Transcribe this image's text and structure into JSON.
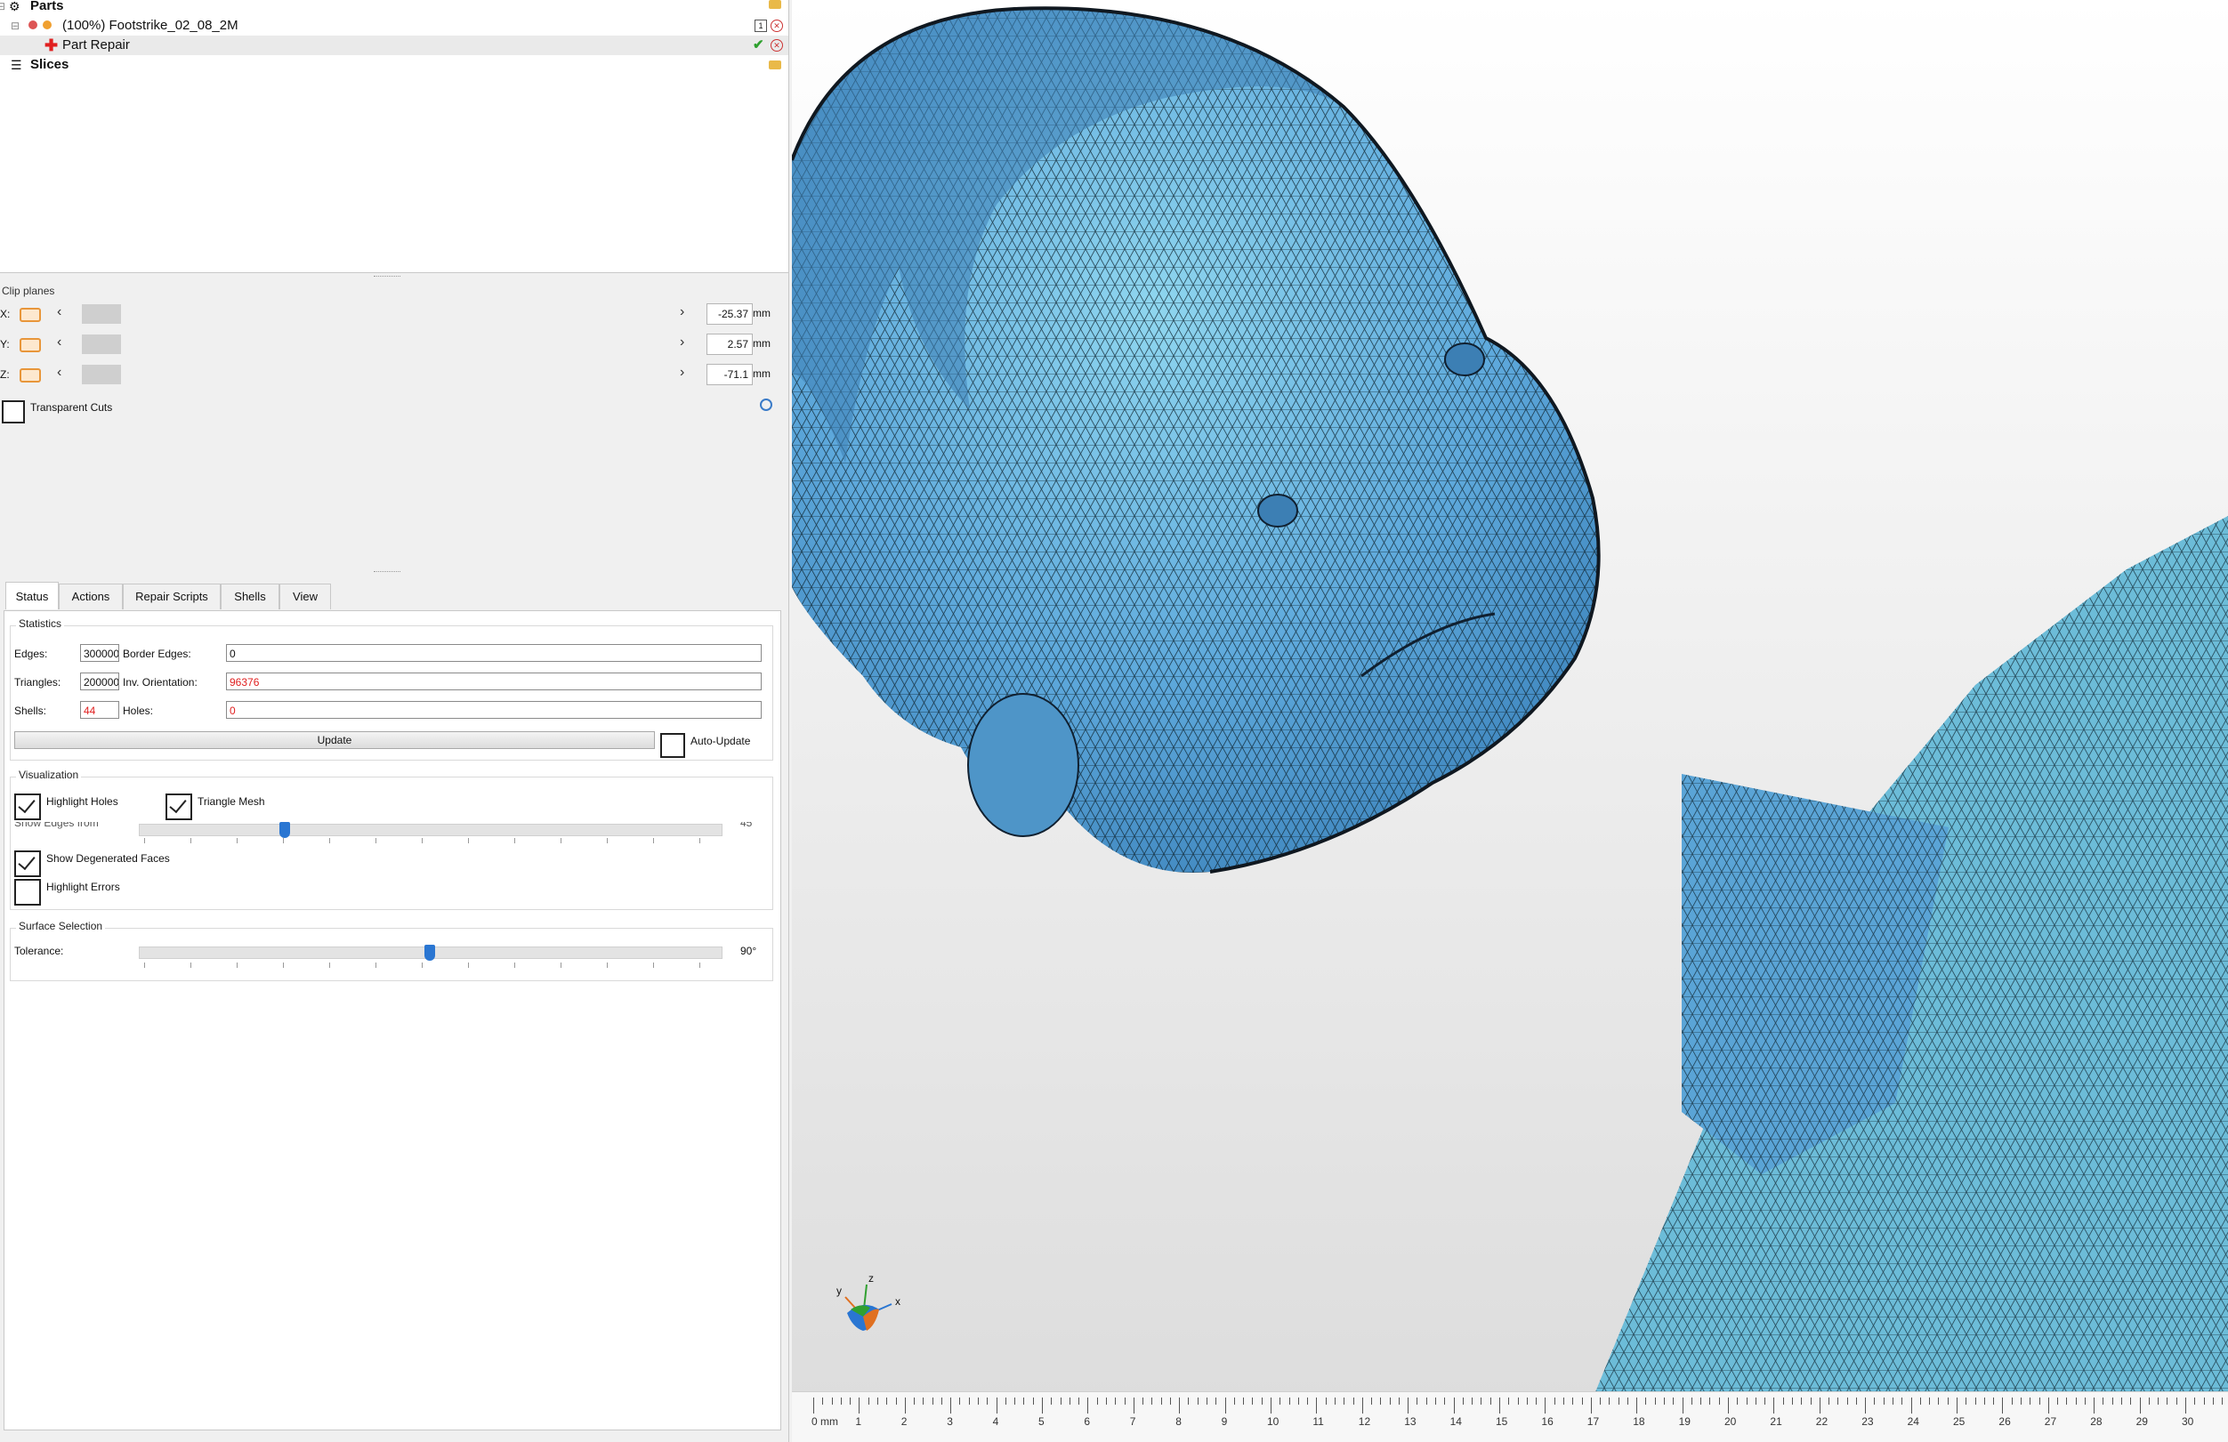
{
  "tree": {
    "parts_label": "Parts",
    "part_name": "(100%) Footstrike_02_08_2M",
    "part_badge": "1",
    "repair_label": "Part Repair",
    "slices_label": "Slices"
  },
  "clip_planes": {
    "title": "Clip planes",
    "rows": [
      {
        "axis": "X:",
        "value": "-25.37",
        "unit": "mm"
      },
      {
        "axis": "Y:",
        "value": "2.57",
        "unit": "mm"
      },
      {
        "axis": "Z:",
        "value": "-71.1",
        "unit": "mm"
      }
    ],
    "transparent_cuts_label": "Transparent Cuts",
    "transparent_cuts_checked": false
  },
  "tabs": [
    "Status",
    "Actions",
    "Repair Scripts",
    "Shells",
    "View"
  ],
  "active_tab": "Status",
  "statistics": {
    "title": "Statistics",
    "edges_label": "Edges:",
    "edges_value": "300000",
    "border_edges_label": "Border Edges:",
    "border_edges_value": "0",
    "triangles_label": "Triangles:",
    "triangles_value": "200000",
    "inv_orientation_label": "Inv. Orientation:",
    "inv_orientation_value": "96376",
    "shells_label": "Shells:",
    "shells_value": "44",
    "holes_label": "Holes:",
    "holes_value": "0",
    "update_label": "Update",
    "auto_update_label": "Auto-Update",
    "auto_update_checked": false
  },
  "visualization": {
    "title": "Visualization",
    "highlight_holes_label": "Highlight Holes",
    "highlight_holes_checked": true,
    "triangle_mesh_label": "Triangle Mesh",
    "triangle_mesh_checked": true,
    "show_edges_label": "Show Edges from",
    "show_edges_value": "45",
    "show_edges_fraction": 0.25,
    "show_degenerated_label": "Show Degenerated Faces",
    "show_degenerated_checked": true,
    "highlight_errors_label": "Highlight Errors",
    "highlight_errors_checked": false
  },
  "surface_selection": {
    "title": "Surface Selection",
    "tolerance_label": "Tolerance:",
    "tolerance_value": "90°",
    "tolerance_fraction": 0.5
  },
  "viewport": {
    "axis_x": "x",
    "axis_y": "y",
    "axis_z": "z",
    "ruler_unit_label": "0 mm",
    "ruler_numbers": [
      "1",
      "2",
      "3",
      "4",
      "5",
      "6",
      "7",
      "8",
      "9",
      "10",
      "11",
      "12",
      "13",
      "14",
      "15",
      "16",
      "17",
      "18",
      "19",
      "20",
      "21",
      "22",
      "23",
      "24",
      "25",
      "26",
      "27",
      "28",
      "29",
      "30"
    ],
    "colors": {
      "mesh": "#5ea9dc",
      "mesh_light": "#8fd6ef",
      "background": "#eeeeee"
    }
  }
}
